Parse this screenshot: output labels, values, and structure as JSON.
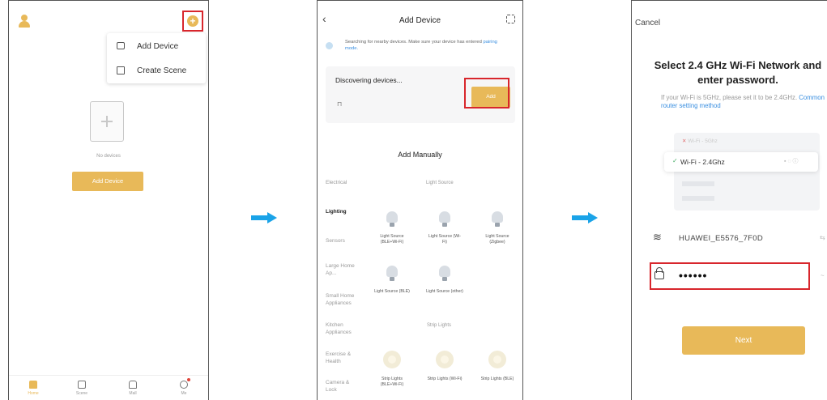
{
  "screen1": {
    "menu": {
      "add_device": "Add Device",
      "create_scene": "Create Scene"
    },
    "empty_text": "No devices",
    "add_device_button": "Add Device",
    "tabs": [
      {
        "label": "Home",
        "icon": "home-icon"
      },
      {
        "label": "Scene",
        "icon": "scene-icon"
      },
      {
        "label": "Mall",
        "icon": "mall-icon"
      },
      {
        "label": "Me",
        "icon": "me-icon"
      }
    ],
    "accent_color": "#e8b959"
  },
  "screen2": {
    "title": "Add Device",
    "search_text": "Searching for nearby devices. Make sure your device has entered",
    "search_link": "pairing mode.",
    "discovering": "Discovering devices...",
    "add_button": "Add",
    "add_manually": "Add Manually",
    "categories": [
      "Electrical",
      "Lighting",
      "Sensors",
      "Large Home Ap...",
      "Small Home Appliances",
      "Kitchen Appliances",
      "Exercise & Health",
      "Camera & Lock"
    ],
    "section_light_source": "Light Source",
    "section_strip_lights": "Strip Lights",
    "devices_row1": [
      "Light Source (BLE+Wi-Fi)",
      "Light Source (Wi-Fi)",
      "Light Source (Zigbee)"
    ],
    "devices_row2": [
      "Light Source (BLE)",
      "Light Source (other)"
    ],
    "devices_row3": [
      "Strip Lights (BLE+Wi-Fi)",
      "Strip Lights (Wi-Fi)",
      "Strip Lights (BLE)"
    ]
  },
  "screen3": {
    "cancel": "Cancel",
    "title": "Select 2.4 GHz Wi-Fi Network and enter password.",
    "subtitle": "If your Wi-Fi is 5GHz, please set it to be 2.4GHz.",
    "subtitle_link": "Common router setting method",
    "wifi_5g": "Wi-Fi - 5Ghz",
    "wifi_24g": "Wi-Fi - 2.4Ghz",
    "network_name": "HUAWEI_E5576_7F0D",
    "password": "••••••",
    "next_button": "Next"
  }
}
